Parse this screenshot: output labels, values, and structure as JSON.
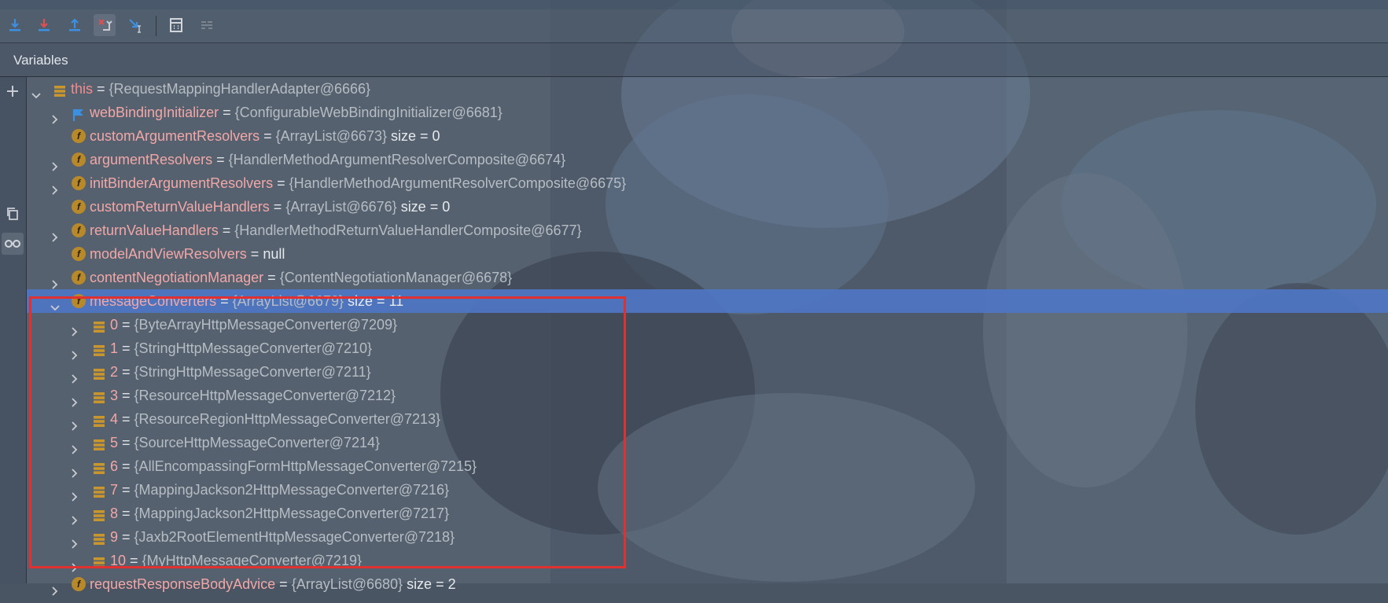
{
  "panel": {
    "title": "Variables"
  },
  "toolbar": {
    "buttons": [
      {
        "name": "step-over-icon",
        "color": "#3d8fe0"
      },
      {
        "name": "step-into-icon",
        "color": "#e05050"
      },
      {
        "name": "step-out-icon",
        "color": "#3d8fe0"
      },
      {
        "name": "drop-frame-icon",
        "color": "#e05050"
      },
      {
        "name": "run-to-cursor-icon",
        "color": "#3d8fe0"
      },
      {
        "name": "evaluate-expression-icon",
        "color": "#c8ccd2"
      },
      {
        "name": "trace-icon",
        "color": "#8a929c"
      }
    ]
  },
  "colors": {
    "selection": "#4f76c4",
    "highlight_box": "#e03030",
    "field_icon": "#b7892a",
    "name": "#f2a7a7"
  },
  "tree": {
    "root": {
      "name": "this",
      "value": "{RequestMappingHandlerAdapter@6666}"
    },
    "fields": [
      {
        "name": "webBindingInitializer",
        "value": "{ConfigurableWebBindingInitializer@6681}",
        "icon": "flag-icon",
        "expandable": true
      },
      {
        "name": "customArgumentResolvers",
        "value": "{ArrayList@6673}",
        "size": "size = 0",
        "icon": "field-icon",
        "expandable": false
      },
      {
        "name": "argumentResolvers",
        "value": "{HandlerMethodArgumentResolverComposite@6674}",
        "icon": "field-icon",
        "expandable": true
      },
      {
        "name": "initBinderArgumentResolvers",
        "value": "{HandlerMethodArgumentResolverComposite@6675}",
        "icon": "field-icon",
        "expandable": true
      },
      {
        "name": "customReturnValueHandlers",
        "value": "{ArrayList@6676}",
        "size": "size = 0",
        "icon": "field-icon",
        "expandable": false
      },
      {
        "name": "returnValueHandlers",
        "value": "{HandlerMethodReturnValueHandlerComposite@6677}",
        "icon": "field-icon",
        "expandable": true
      },
      {
        "name": "modelAndViewResolvers",
        "value": "null",
        "icon": "field-icon",
        "expandable": false
      },
      {
        "name": "contentNegotiationManager",
        "value": "{ContentNegotiationManager@6678}",
        "icon": "field-icon",
        "expandable": true
      },
      {
        "name": "messageConverters",
        "value": "{ArrayList@6679}",
        "size": "size = 11",
        "icon": "field-icon",
        "expandable": true,
        "expanded": true,
        "selected": true
      }
    ],
    "converters": [
      {
        "index": "0",
        "value": "{ByteArrayHttpMessageConverter@7209}"
      },
      {
        "index": "1",
        "value": "{StringHttpMessageConverter@7210}"
      },
      {
        "index": "2",
        "value": "{StringHttpMessageConverter@7211}"
      },
      {
        "index": "3",
        "value": "{ResourceHttpMessageConverter@7212}"
      },
      {
        "index": "4",
        "value": "{ResourceRegionHttpMessageConverter@7213}"
      },
      {
        "index": "5",
        "value": "{SourceHttpMessageConverter@7214}"
      },
      {
        "index": "6",
        "value": "{AllEncompassingFormHttpMessageConverter@7215}"
      },
      {
        "index": "7",
        "value": "{MappingJackson2HttpMessageConverter@7216}"
      },
      {
        "index": "8",
        "value": "{MappingJackson2HttpMessageConverter@7217}"
      },
      {
        "index": "9",
        "value": "{Jaxb2RootElementHttpMessageConverter@7218}"
      },
      {
        "index": "10",
        "value": "{MyHttpMessageConverter@7219}"
      }
    ],
    "trailing": {
      "name": "requestResponseBodyAdvice",
      "value": "{ArrayList@6680}",
      "size": "size = 2"
    }
  }
}
